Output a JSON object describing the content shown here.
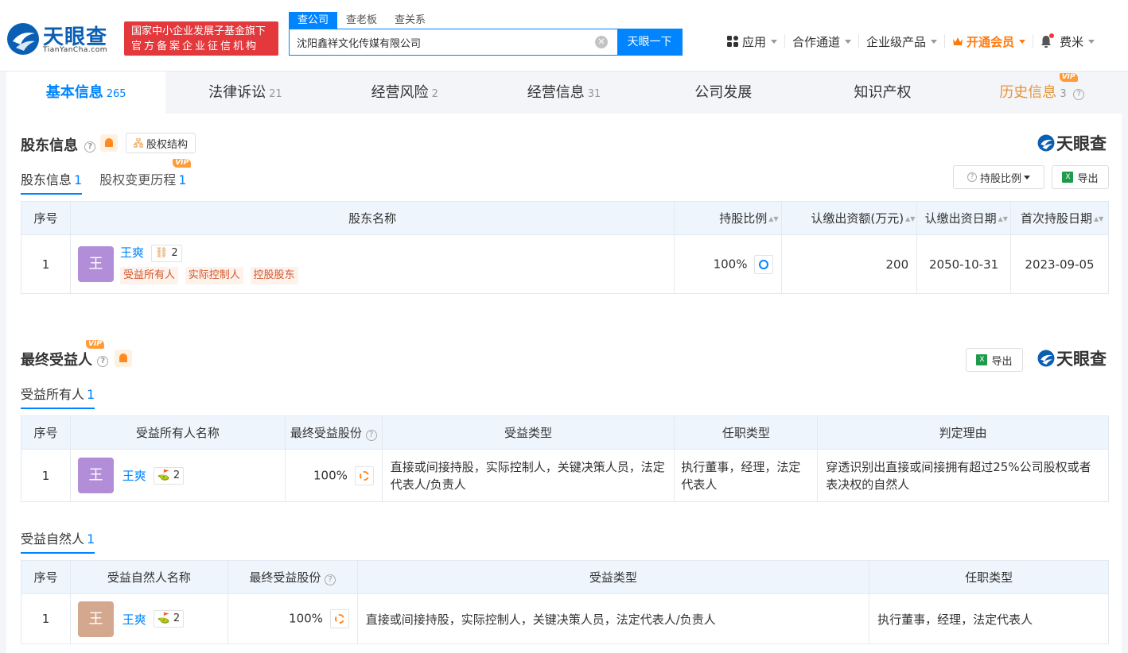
{
  "header": {
    "logo_title": "天眼查",
    "logo_domain": "TianYanCha.com",
    "gov_badge_line1": "国家中小企业发展子基金旗下",
    "gov_badge_line2": "官方备案企业征信机构",
    "search_tabs": [
      "查公司",
      "查老板",
      "查关系"
    ],
    "search_value": "沈阳鑫祥文化传媒有限公司",
    "search_button": "天眼一下",
    "nav": {
      "apps": "应用",
      "partners": "合作通道",
      "enterprise": "企业级产品",
      "vip": "开通会员",
      "user": "费米"
    }
  },
  "main_tabs": [
    {
      "label": "基本信息",
      "count": "265"
    },
    {
      "label": "法律诉讼",
      "count": "21"
    },
    {
      "label": "经营风险",
      "count": "2"
    },
    {
      "label": "经营信息",
      "count": "31"
    },
    {
      "label": "公司发展",
      "count": ""
    },
    {
      "label": "知识产权",
      "count": ""
    },
    {
      "label": "历史信息",
      "count": "3"
    }
  ],
  "vip_label": "VIP",
  "brand": "天眼查",
  "shareholders": {
    "title": "股东信息",
    "equity_button": "股权结构",
    "subtabs": [
      {
        "label": "股东信息",
        "count": "1"
      },
      {
        "label": "股权变更历程",
        "count": "1"
      }
    ],
    "ratio_button": "持股比例",
    "export_button": "导出",
    "columns": [
      "序号",
      "股东名称",
      "持股比例",
      "认缴出资额(万元)",
      "认缴出资日期",
      "首次持股日期"
    ],
    "rows": [
      {
        "index": "1",
        "avatar": "王",
        "name": "王爽",
        "relations": "2",
        "tags": [
          "受益所有人",
          "实际控制人",
          "控股股东"
        ],
        "ratio": "100%",
        "amount": "200",
        "subscribe_date": "2050-10-31",
        "first_date": "2023-09-05"
      }
    ]
  },
  "beneficiary": {
    "title": "最终受益人",
    "export_button": "导出",
    "owner": {
      "subtitle": "受益所有人",
      "count": "1",
      "columns": [
        "序号",
        "受益所有人名称",
        "最终受益股份",
        "受益类型",
        "任职类型",
        "判定理由"
      ],
      "rows": [
        {
          "index": "1",
          "avatar": "王",
          "name": "王爽",
          "relations": "2",
          "share": "100%",
          "type": "直接或间接持股，实际控制人，关键决策人员，法定代表人/负责人",
          "position": "执行董事，经理，法定代表人",
          "reason": "穿透识别出直接或间接拥有超过25%公司股权或者表决权的自然人"
        }
      ]
    },
    "natural": {
      "subtitle": "受益自然人",
      "count": "1",
      "columns": [
        "序号",
        "受益自然人名称",
        "最终受益股份",
        "受益类型",
        "任职类型"
      ],
      "rows": [
        {
          "index": "1",
          "avatar": "王",
          "name": "王爽",
          "relations": "2",
          "share": "100%",
          "type": "直接或间接持股，实际控制人，关键决策人员，法定代表人/负责人",
          "position": "执行董事，经理，法定代表人"
        }
      ]
    }
  },
  "colors": {
    "primary": "#0084ff",
    "vip": "#ff7a0f",
    "avatar_purple": "#b28dd8",
    "avatar_tan": "#d4a88f",
    "gov_red": "#e3393c"
  }
}
